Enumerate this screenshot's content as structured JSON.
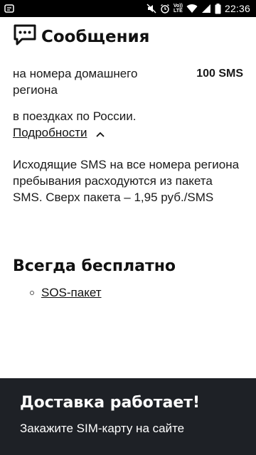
{
  "status_bar": {
    "time": "22:36",
    "network_label": "LTE",
    "volte_label": "Vo))",
    "icons": [
      "app-notification-icon",
      "mute-icon",
      "alarm-icon",
      "volte-icon",
      "wifi-icon",
      "signal-icon",
      "battery-icon"
    ]
  },
  "header": {
    "title": "Сообщения",
    "icon": "message-bubble-icon"
  },
  "items": [
    {
      "description": "на номера домашнего региона",
      "value": "100 SMS"
    }
  ],
  "travel": {
    "text": "в поездках по России.",
    "link_label": "Подробности",
    "link_icon": "chevron-up-icon"
  },
  "paragraph": "Исходящие SMS на все номера региона пребывания расходуются из пакета SMS. Сверх пакета – 1,95 руб./SMS",
  "free_section": {
    "title": "Всегда бесплатно",
    "items": [
      "SOS-пакет"
    ]
  },
  "banner": {
    "title": "Доставка работает!",
    "subtitle": "Закажите SIM-карту на сайте"
  },
  "colors": {
    "status_bar_bg": "#000000",
    "banner_bg": "#1e2126",
    "text": "#1a1a1a"
  }
}
